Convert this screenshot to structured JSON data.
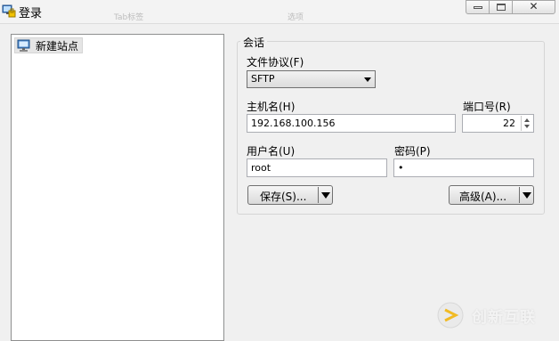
{
  "window": {
    "title": "登录",
    "ghost_labels": [
      "Tab标签",
      "选项"
    ],
    "close_glyph": "✕"
  },
  "site_tree": {
    "items": [
      {
        "label": "新建站点",
        "icon": "monitor-icon"
      }
    ]
  },
  "session": {
    "group_title": "会话",
    "protocol_label": "文件协议(F)",
    "protocol_value": "SFTP",
    "host_label": "主机名(H)",
    "host_value": "192.168.100.156",
    "port_label": "端口号(R)",
    "port_value": "22",
    "user_label": "用户名(U)",
    "user_value": "root",
    "password_label": "密码(P)",
    "password_value": "•"
  },
  "buttons": {
    "save": "保存(S)...",
    "advanced": "高级(A)..."
  },
  "watermark": {
    "text": "创新互联"
  }
}
